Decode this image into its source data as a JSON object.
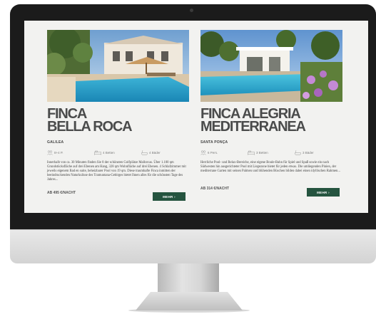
{
  "cards": [
    {
      "title_line1": "FINCA",
      "title_line2": "BELLA ROCA",
      "location": "GALILEA",
      "persons": "8+4 P.",
      "beds": "4 Betten",
      "baths": "4 Bäder",
      "description": "Innerhalb von ca. 30 Minuten finden Sie 8 der schönsten Golfplätze Mallorcas. Über 1.100 qm Grundstücksfläche auf drei Ebenen am Hang, 328 qm Wohnfläche auf drei Ebenen. 4 Schlafzimmer mit jeweils eigenem Bad en suite, beheizbarer Pool von 19 qm. Diese traumhafte Finca inmitten der beeindruckenden Naturkulisse des Tramuntana-Gebirges bietet Ihnen alles für die schönsten Tage des Jahres...",
      "price": "AB 495 €/NACHT",
      "button": "MEHR ›"
    },
    {
      "title_line1": "FINCA ALEGRIA",
      "title_line2": "MEDITERRANEA",
      "location": "SANTA PONÇA",
      "persons": "6 Pers.",
      "beds": "3 Betten",
      "baths": "3 Bäder",
      "description": "Herrliche Pool- und Relax-Bereiche, eine eigene Boule-Bahn für Spiel und Spaß sowie ein nach Südwesten hin ausgerichteter Pool mit Liegezone bietet für jeden etwas. Die umliegenden Pinien, der mediterrane Garten mit seinen Palmen und blühenden Büschen bilden dabei einen idyllischen Rahmen...",
      "price": "AB 314 €/NACHT",
      "button": "MEHR ›"
    }
  ],
  "colors": {
    "accent": "#25543f",
    "title": "#4a4b4b",
    "pool": "#2aa3c8"
  }
}
